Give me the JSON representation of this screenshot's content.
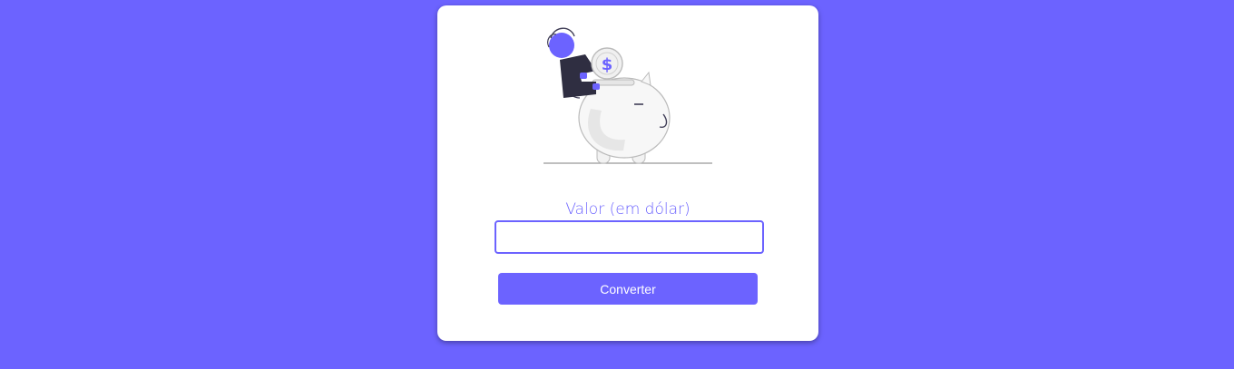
{
  "form": {
    "label": "Valor (em dólar)",
    "input_value": "",
    "input_placeholder": "",
    "button_label": "Converter"
  },
  "illustration": {
    "icon": "piggy-bank-savings-illustration",
    "coin_symbol": "$"
  },
  "colors": {
    "background": "#6c63ff",
    "accent": "#6c63ff",
    "card": "#ffffff"
  }
}
